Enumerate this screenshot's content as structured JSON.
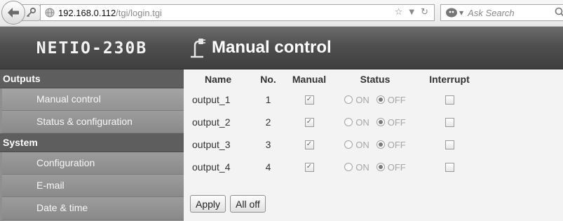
{
  "browser": {
    "url_host": "192.168.0.112",
    "url_path": "/tgi/login.tgi",
    "search_placeholder": "Ask Search"
  },
  "header": {
    "brand": "NETIO-230B",
    "title": "Manual control"
  },
  "sidebar": {
    "sections": [
      {
        "label": "Outputs",
        "items": [
          "Manual control",
          "Status & configuration"
        ]
      },
      {
        "label": "System",
        "items": [
          "Configuration",
          "E-mail",
          "Date & time"
        ]
      }
    ],
    "active_item": "Manual control"
  },
  "table": {
    "columns": [
      "Name",
      "No.",
      "Manual",
      "Status",
      "Interrupt"
    ],
    "on_label": "ON",
    "off_label": "OFF",
    "rows": [
      {
        "name": "output_1",
        "no": "1",
        "manual": true,
        "status": "OFF",
        "interrupt": false
      },
      {
        "name": "output_2",
        "no": "2",
        "manual": true,
        "status": "OFF",
        "interrupt": false
      },
      {
        "name": "output_3",
        "no": "3",
        "manual": true,
        "status": "OFF",
        "interrupt": false
      },
      {
        "name": "output_4",
        "no": "4",
        "manual": true,
        "status": "OFF",
        "interrupt": false
      }
    ]
  },
  "actions": {
    "apply": "Apply",
    "all_off": "All off"
  }
}
